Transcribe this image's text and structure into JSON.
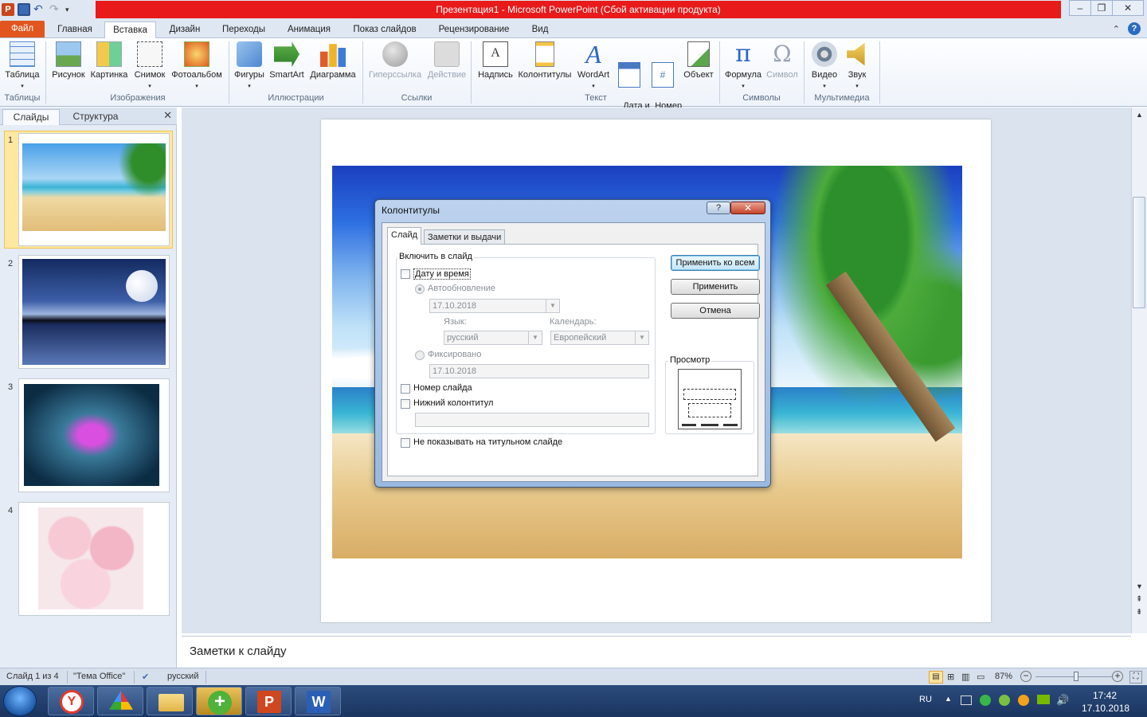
{
  "window": {
    "title": "Презентация1 - Microsoft PowerPoint (Сбой активации продукта)",
    "controls": [
      "–",
      "❐",
      "✕"
    ]
  },
  "ribbon": {
    "tabs": [
      "Файл",
      "Главная",
      "Вставка",
      "Дизайн",
      "Переходы",
      "Анимация",
      "Показ слайдов",
      "Рецензирование",
      "Вид"
    ],
    "active_tab": "Вставка",
    "help": "?",
    "groups": {
      "tables": {
        "label": "Таблицы",
        "buttons": [
          "Таблица"
        ]
      },
      "images": {
        "label": "Изображения",
        "buttons": [
          "Рисунок",
          "Картинка",
          "Снимок",
          "Фотоальбом"
        ]
      },
      "illustrations": {
        "label": "Иллюстрации",
        "buttons": [
          "Фигуры",
          "SmartArt",
          "Диаграмма"
        ]
      },
      "links": {
        "label": "Ссылки",
        "buttons": [
          "Гиперссылка",
          "Действие"
        ]
      },
      "text": {
        "label": "Текст",
        "buttons": [
          "Надпись",
          "Колонтитулы",
          "WordArt",
          "Дата и\nвремя",
          "Номер\nслайда",
          "Объект"
        ]
      },
      "symbols": {
        "label": "Символы",
        "buttons": [
          "Формула",
          "Символ"
        ]
      },
      "media": {
        "label": "Мультимедиа",
        "buttons": [
          "Видео",
          "Звук"
        ]
      }
    }
  },
  "left_pane": {
    "tabs": [
      "Слайды",
      "Структура"
    ],
    "close": "✕",
    "slides": [
      "1",
      "2",
      "3",
      "4"
    ]
  },
  "notes": {
    "placeholder": "Заметки к слайду"
  },
  "status": {
    "slide": "Слайд 1 из 4",
    "theme": "\"Тема Office\"",
    "lang": "русский",
    "zoom": "87%",
    "zoom_fraction": 0.53
  },
  "taskbar": {
    "lang": "RU",
    "time": "17:42",
    "date": "17.10.2018"
  },
  "dialog": {
    "title": "Колонтитулы",
    "help": "?",
    "close": "✕",
    "tabs": [
      "Слайд",
      "Заметки и выдачи"
    ],
    "include_group": "Включить в слайд",
    "date_time": "Дату и время",
    "auto_update": "Автообновление",
    "auto_date": "17.10.2018",
    "lang_label": "Язык:",
    "lang_value": "русский",
    "cal_label": "Календарь:",
    "cal_value": "Европейский",
    "fixed": "Фиксировано",
    "fixed_date": "17.10.2018",
    "slide_number": "Номер слайда",
    "footer": "Нижний колонтитул",
    "footer_value": "",
    "no_title": "Не показывать на титульном слайде",
    "preview": "Просмотр",
    "btn_apply_all": "Применить ко всем",
    "btn_apply": "Применить",
    "btn_cancel": "Отмена"
  }
}
